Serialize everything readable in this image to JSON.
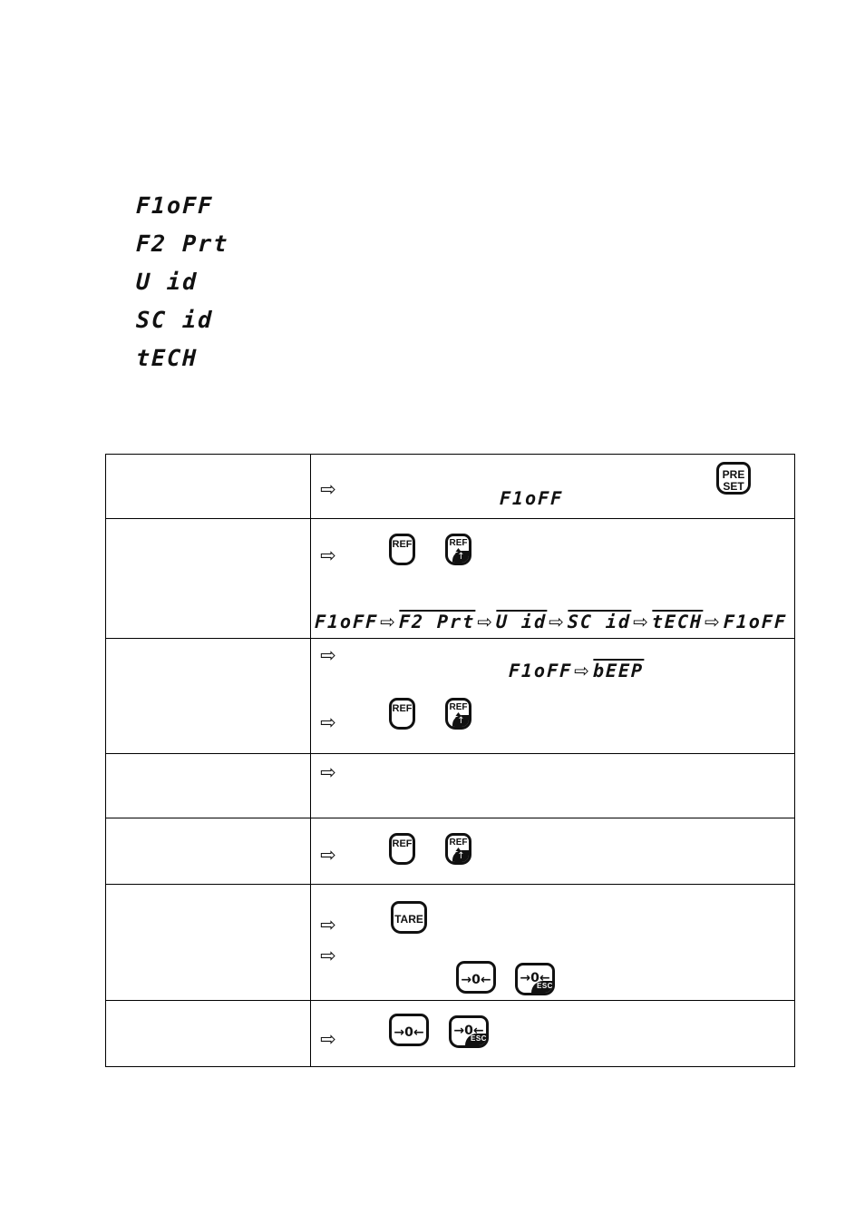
{
  "display_codes": [
    {
      "text": "F1oFF",
      "overline": false
    },
    {
      "text": "F2 Prt",
      "overline": true
    },
    {
      "text": "U id",
      "overline": true
    },
    {
      "text": "SC id",
      "overline": true
    },
    {
      "text": "tECH",
      "overline": true
    }
  ],
  "keys": {
    "preset": {
      "line1": "PRE",
      "line2": "SET"
    },
    "ref": {
      "label": "REF"
    },
    "ref_piece": {
      "label": "REF",
      "arrow": "↑"
    },
    "tare": {
      "label": "TARE"
    },
    "zero": {
      "label": "→0←"
    },
    "zero_esc": {
      "label": "→0←",
      "badge": "ESC"
    }
  },
  "arrow_marker": "⇨",
  "table": {
    "rows": [
      {
        "left": "",
        "right": {
          "lcd": [
            {
              "text": "F1oFF",
              "overline": false
            }
          ],
          "keys": [
            "preset"
          ]
        }
      },
      {
        "left": "",
        "right": {
          "sequence": [
            {
              "text": "F1oFF",
              "overline": false
            },
            {
              "text": "F2 Prt",
              "overline": true
            },
            {
              "text": "U id",
              "overline": true
            },
            {
              "text": "SC id",
              "overline": true
            },
            {
              "text": "tECH",
              "overline": true
            },
            {
              "text": "F1oFF",
              "overline": false
            }
          ],
          "keys": [
            "ref",
            "ref_piece"
          ]
        }
      },
      {
        "left": "",
        "right": {
          "sequence2": [
            {
              "text": "F1oFF",
              "overline": false
            },
            {
              "text": "bEEP",
              "overline": true
            }
          ],
          "keys": [
            "ref",
            "ref_piece"
          ]
        }
      },
      {
        "left": "",
        "right": {
          "keys": []
        }
      },
      {
        "left": "",
        "right": {
          "keys": [
            "ref",
            "ref_piece"
          ]
        }
      },
      {
        "left": "",
        "right": {
          "keys": [
            "tare",
            "zero",
            "zero_esc"
          ]
        }
      },
      {
        "left": "",
        "right": {
          "keys": [
            "zero",
            "zero_esc"
          ]
        }
      }
    ]
  }
}
